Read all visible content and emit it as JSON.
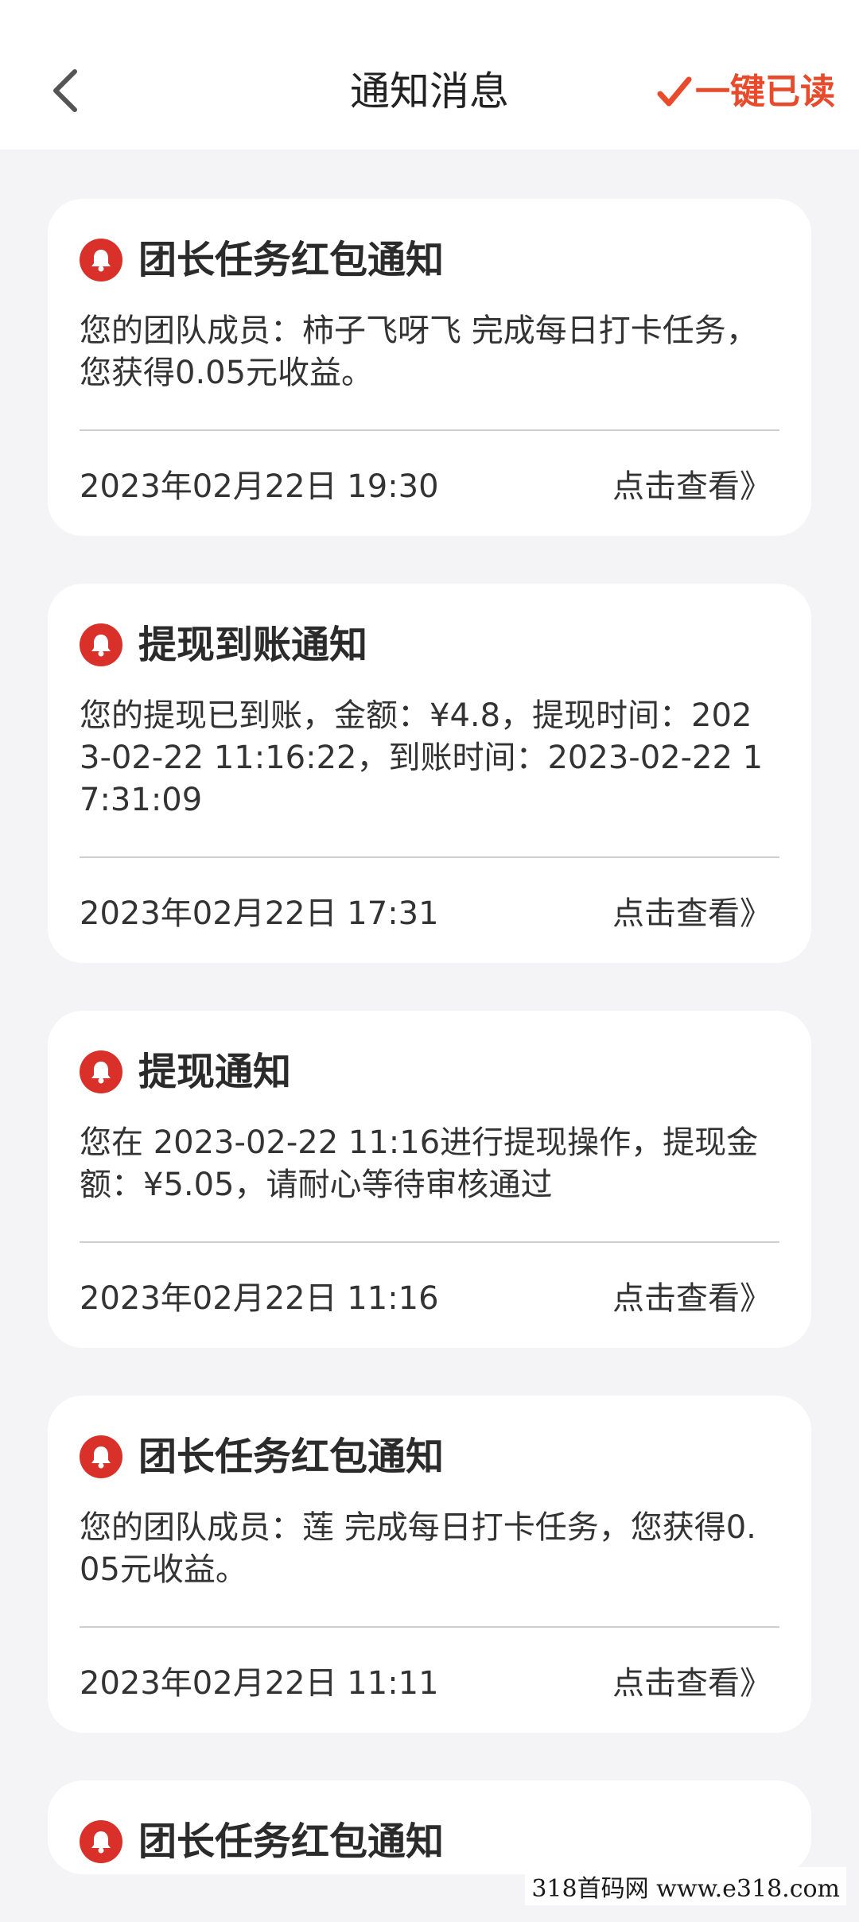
{
  "header": {
    "title": "通知消息",
    "mark_all_label": "一键已读",
    "accent_color": "#e84a2c"
  },
  "notifications": [
    {
      "title": "团长任务红包通知",
      "body": "您的团队成员：柿子飞呀飞 完成每日打卡任务，您获得0.05元收益。",
      "time": "2023年02月22日 19:30",
      "action": "点击查看》"
    },
    {
      "title": "提现到账通知",
      "body": "您的提现已到账，金额：¥4.8，提现时间：2023-02-22 11:16:22，到账时间：2023-02-22 17:31:09",
      "time": "2023年02月22日 17:31",
      "action": "点击查看》"
    },
    {
      "title": "提现通知",
      "body": "您在 2023-02-22 11:16进行提现操作，提现金额：¥5.05，请耐心等待审核通过",
      "time": "2023年02月22日 11:16",
      "action": "点击查看》"
    },
    {
      "title": "团长任务红包通知",
      "body": "您的团队成员：莲 完成每日打卡任务，您获得0.05元收益。",
      "time": "2023年02月22日 11:11",
      "action": "点击查看》"
    },
    {
      "title": "团长任务红包通知"
    }
  ],
  "icons": {
    "back": "chevron-left-icon",
    "check": "check-icon",
    "bell": "bell-icon"
  },
  "bell_color": "#d9302a",
  "watermark": "318首码网  www.e318.com"
}
